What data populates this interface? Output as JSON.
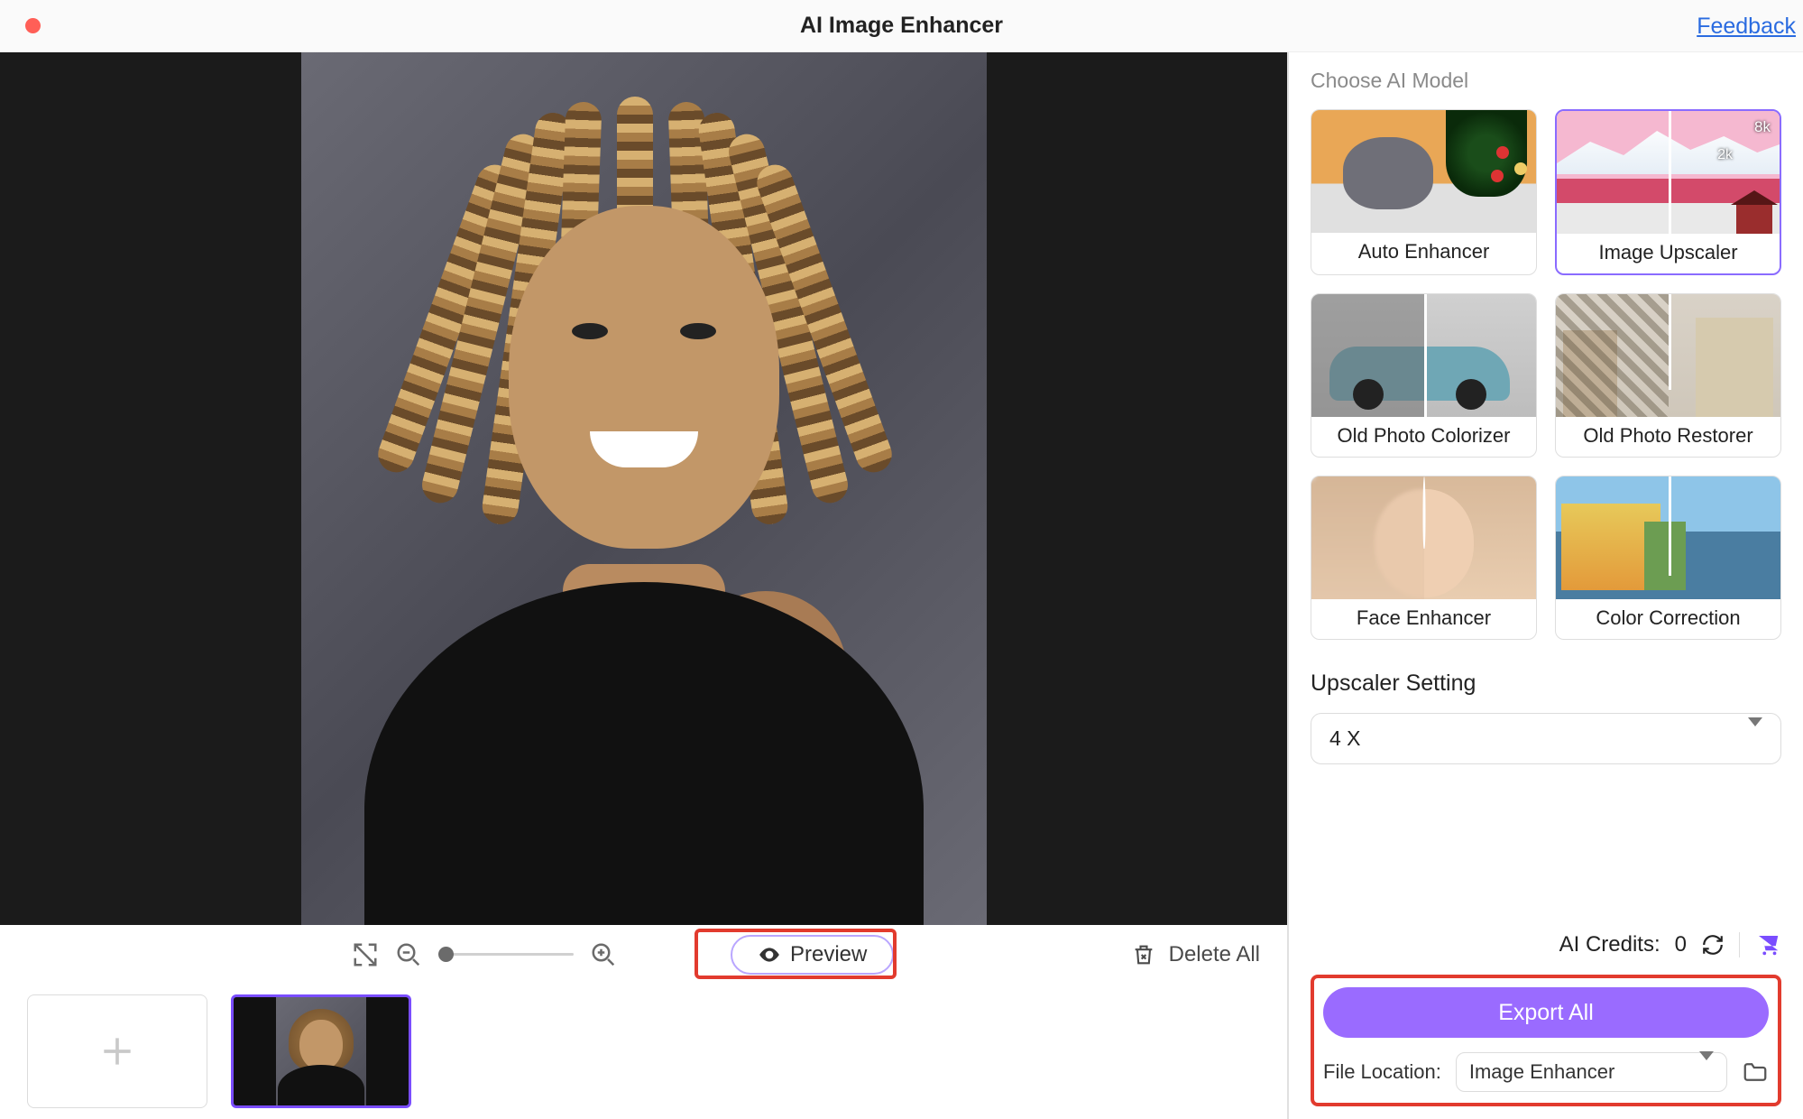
{
  "titlebar": {
    "title": "AI Image Enhancer",
    "feedback": "Feedback"
  },
  "toolbar": {
    "preview_label": "Preview",
    "delete_all_label": "Delete All"
  },
  "sidebar": {
    "choose_model_label": "Choose AI Model",
    "models": [
      {
        "label": "Auto Enhancer"
      },
      {
        "label": "Image Upscaler"
      },
      {
        "label": "Old Photo Colorizer"
      },
      {
        "label": "Old Photo Restorer"
      },
      {
        "label": "Face Enhancer"
      },
      {
        "label": "Color Correction"
      }
    ],
    "upscaler_badge_8k": "8k",
    "upscaler_badge_2k": "2k",
    "upscaler_setting_label": "Upscaler Setting",
    "upscaler_value": "4 X",
    "credits_label": "AI Credits:",
    "credits_value": "0",
    "export_label": "Export All",
    "file_location_label": "File Location:",
    "file_location_value": "Image Enhancer"
  }
}
